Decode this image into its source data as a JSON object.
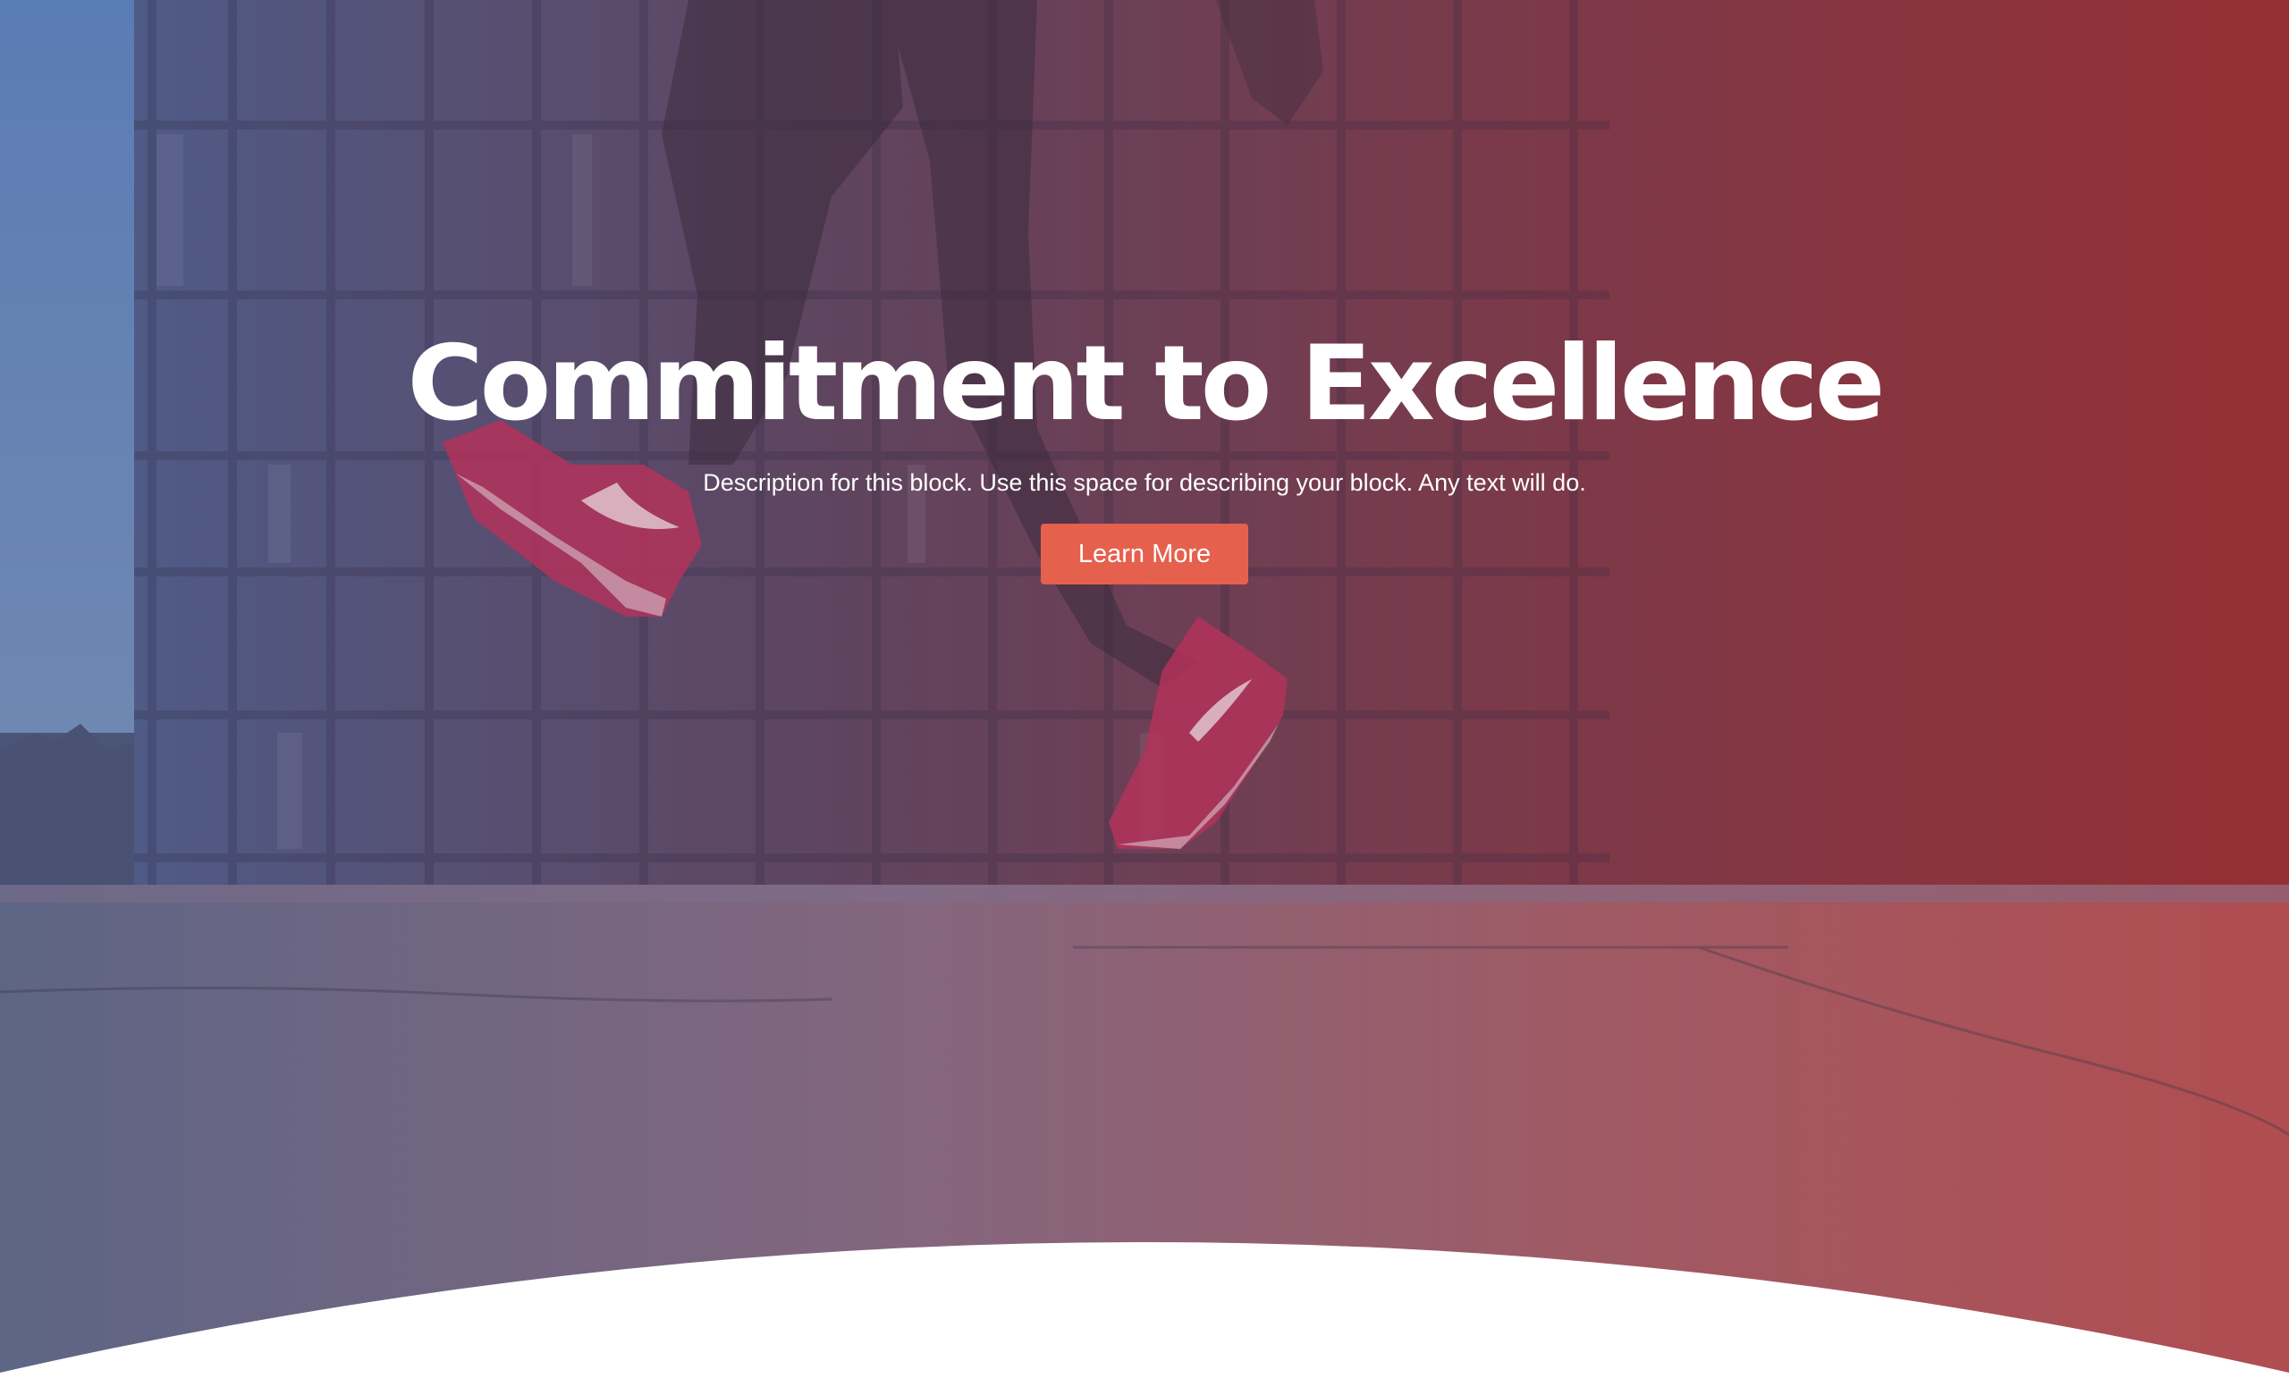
{
  "hero": {
    "title": "Commitment to Excellence",
    "description": "Description for this block. Use this space for describing your block. Any text will do.",
    "button_label": "Learn More"
  },
  "colors": {
    "overlay_left": "#4f6aa3",
    "overlay_mid": "#6a4a6d",
    "overlay_right": "#993238",
    "button": "#e6604e",
    "background": "#ffffff"
  },
  "background_image": {
    "icon": "photo-person-jumping-red-sneakers"
  }
}
